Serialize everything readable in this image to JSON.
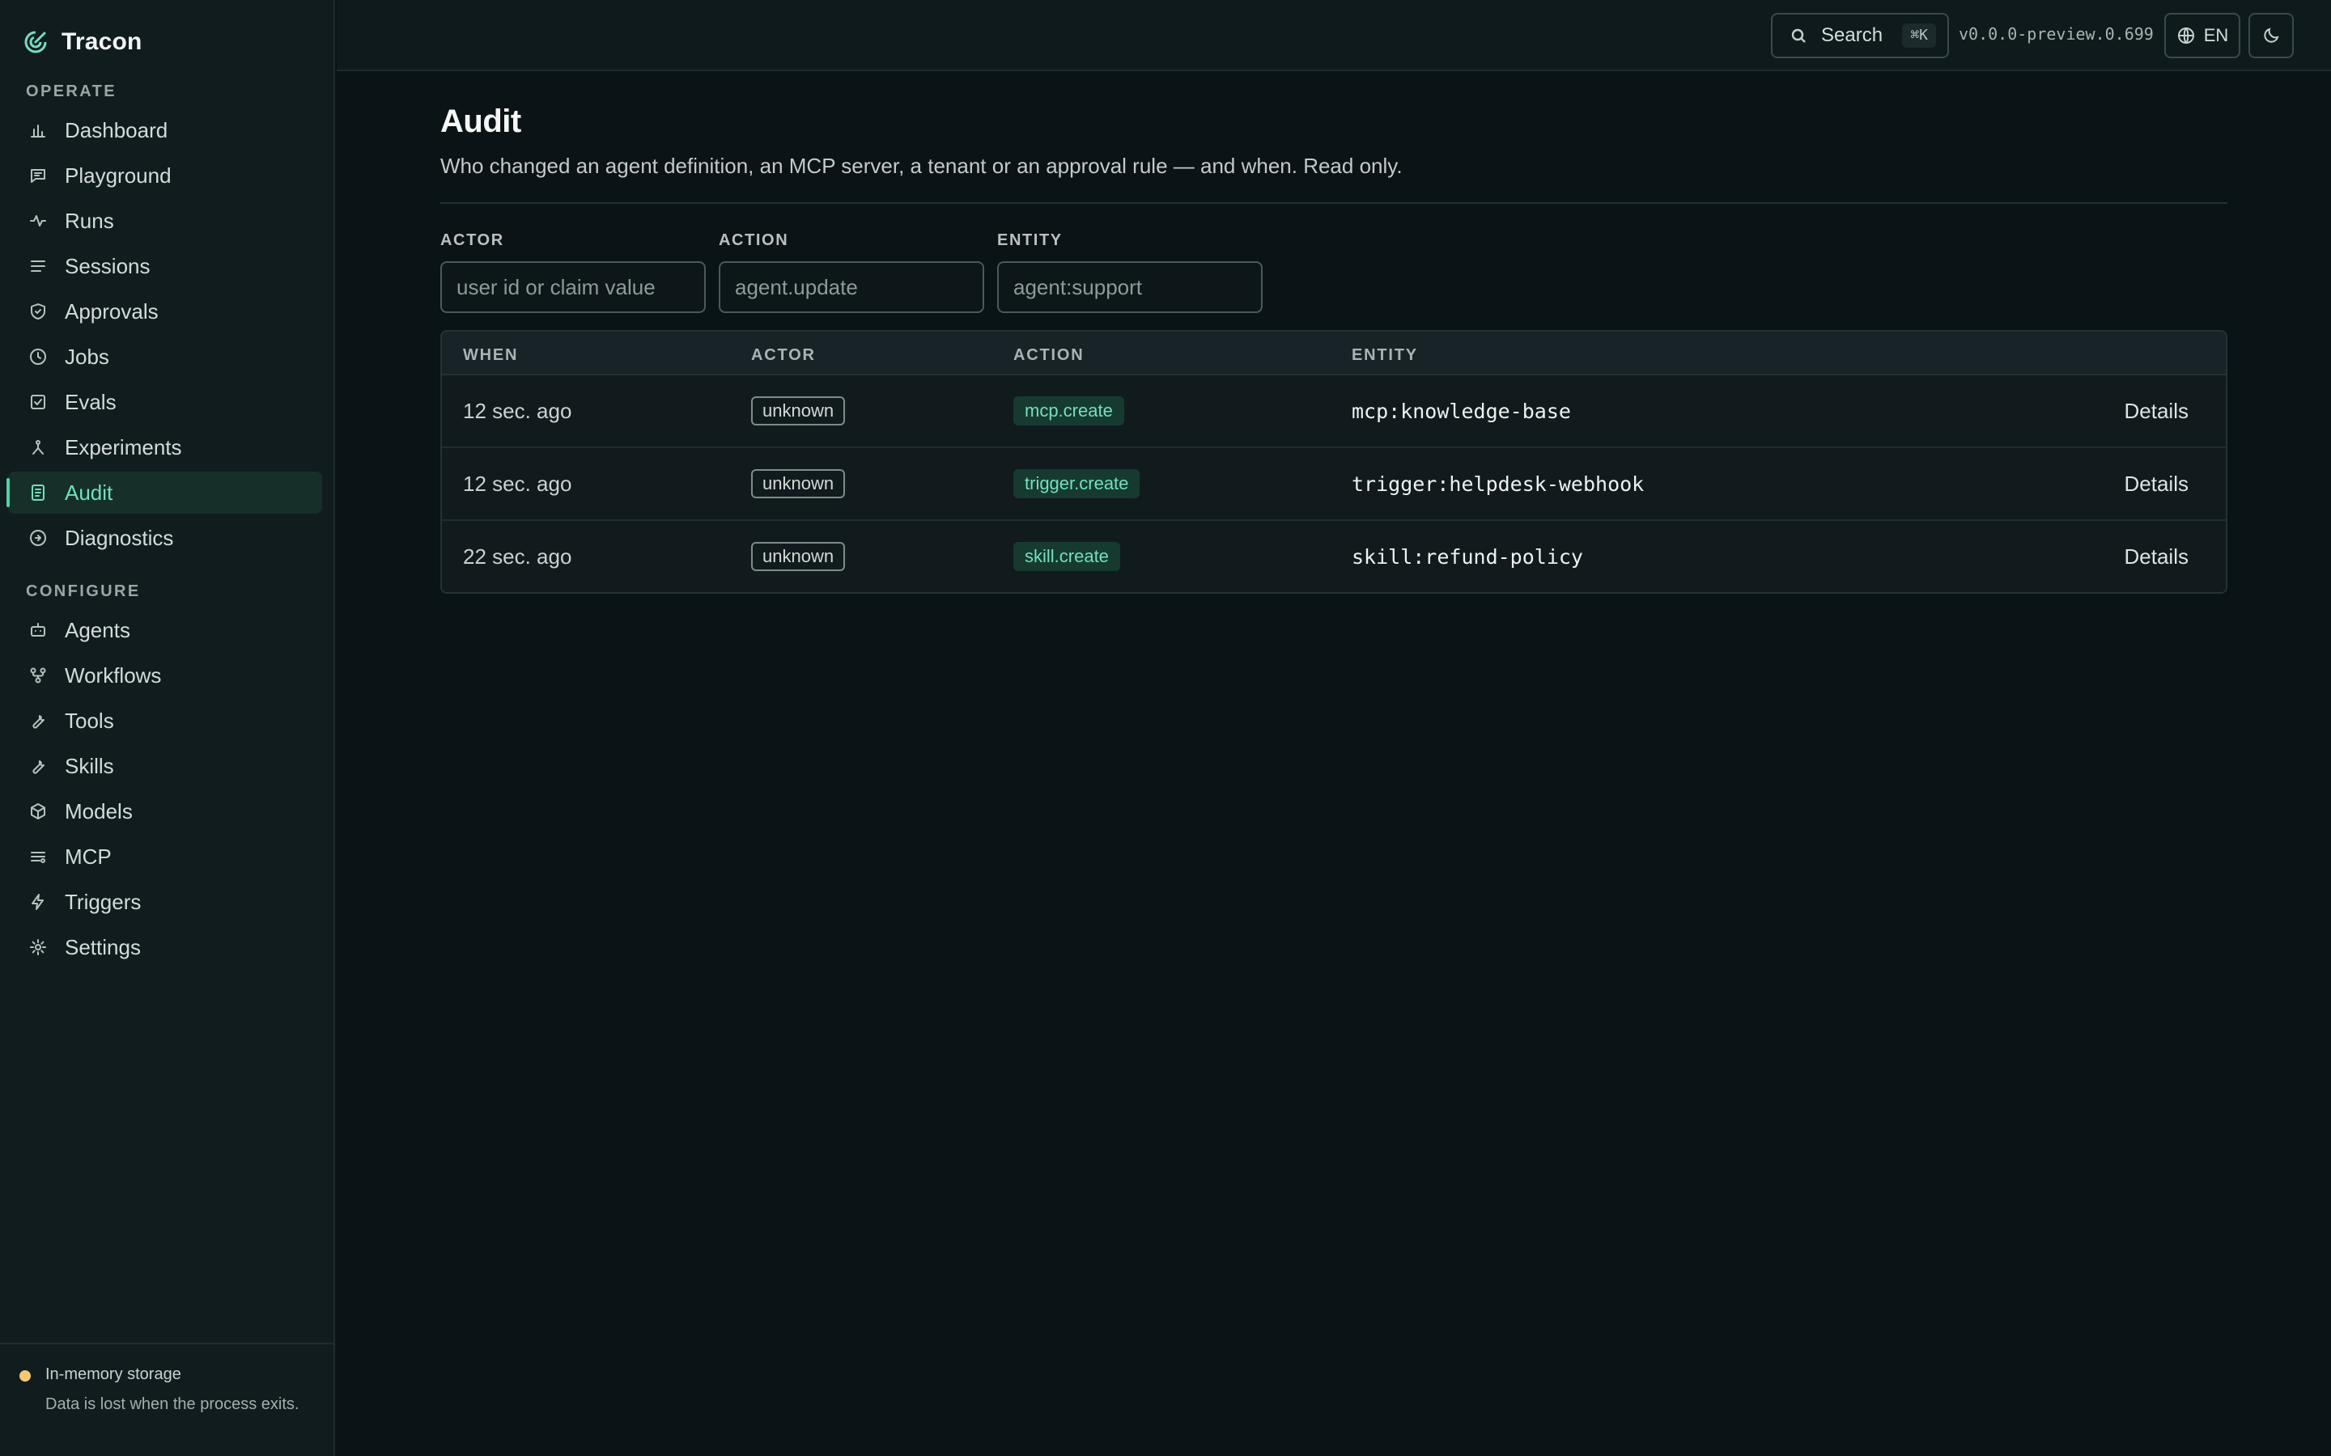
{
  "app": {
    "name": "Tracon"
  },
  "sidebar": {
    "operate_label": "OPERATE",
    "configure_label": "CONFIGURE",
    "operate_items": [
      {
        "label": "Dashboard",
        "icon": "bar-chart-icon"
      },
      {
        "label": "Playground",
        "icon": "message-square-icon"
      },
      {
        "label": "Runs",
        "icon": "activity-icon"
      },
      {
        "label": "Sessions",
        "icon": "list-icon"
      },
      {
        "label": "Approvals",
        "icon": "shield-check-icon"
      },
      {
        "label": "Jobs",
        "icon": "clock-icon"
      },
      {
        "label": "Evals",
        "icon": "check-square-icon"
      },
      {
        "label": "Experiments",
        "icon": "flask-icon"
      },
      {
        "label": "Audit",
        "icon": "file-text-icon",
        "active": true
      },
      {
        "label": "Diagnostics",
        "icon": "arrow-circle-icon"
      }
    ],
    "configure_items": [
      {
        "label": "Agents",
        "icon": "bot-icon"
      },
      {
        "label": "Workflows",
        "icon": "workflow-icon"
      },
      {
        "label": "Tools",
        "icon": "wrench-icon"
      },
      {
        "label": "Skills",
        "icon": "wrench-icon"
      },
      {
        "label": "Models",
        "icon": "box-icon"
      },
      {
        "label": "MCP",
        "icon": "server-list-icon"
      },
      {
        "label": "Triggers",
        "icon": "zap-icon"
      },
      {
        "label": "Settings",
        "icon": "sun-gear-icon"
      }
    ],
    "storage": {
      "title": "In-memory storage",
      "description": "Data is lost when the process exits.",
      "status_color": "#f6c971"
    }
  },
  "topbar": {
    "search_label": "Search",
    "search_shortcut": "⌘K",
    "version": "v0.0.0-preview.0.699",
    "language": "EN"
  },
  "page": {
    "title": "Audit",
    "description": "Who changed an agent definition, an MCP server, a tenant or an approval rule — and when. Read only."
  },
  "filters": {
    "actor": {
      "label": "ACTOR",
      "placeholder": "user id or claim value"
    },
    "action": {
      "label": "ACTION",
      "placeholder": "agent.update"
    },
    "entity": {
      "label": "ENTITY",
      "placeholder": "agent:support"
    }
  },
  "table": {
    "headers": {
      "when": "WHEN",
      "actor": "ACTOR",
      "action": "ACTION",
      "entity": "ENTITY"
    },
    "rows": [
      {
        "when": "12 sec. ago",
        "actor": "unknown",
        "action": "mcp.create",
        "entity": "mcp:knowledge-base",
        "details": "Details"
      },
      {
        "when": "12 sec. ago",
        "actor": "unknown",
        "action": "trigger.create",
        "entity": "trigger:helpdesk-webhook",
        "details": "Details"
      },
      {
        "when": "22 sec. ago",
        "actor": "unknown",
        "action": "skill.create",
        "entity": "skill:refund-policy",
        "details": "Details"
      }
    ]
  },
  "colors": {
    "accent": "#4fd1ad",
    "background": "#0a1315",
    "sidebar": "#111c1f"
  }
}
